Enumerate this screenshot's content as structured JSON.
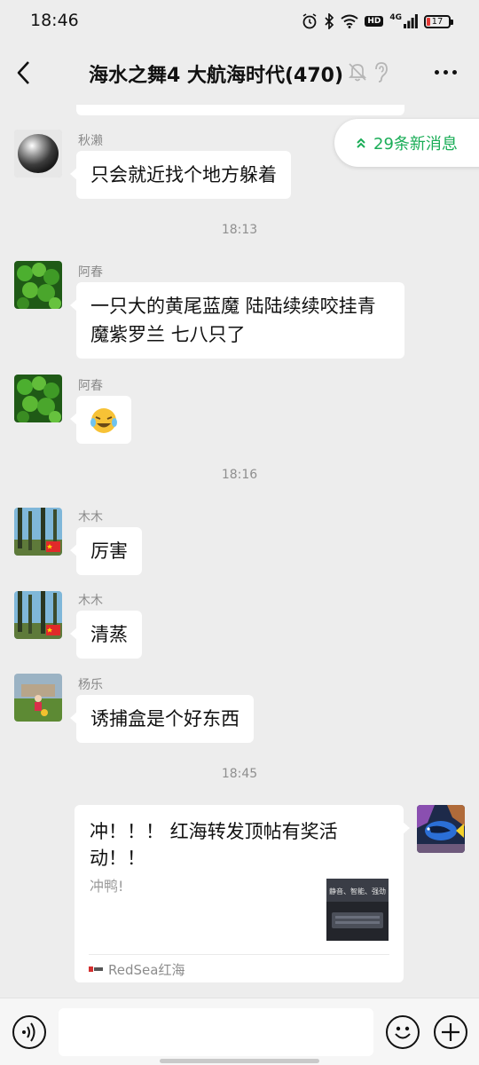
{
  "status_bar": {
    "time": "18:46",
    "battery": "17",
    "network": "4G",
    "hd_badge": "HD"
  },
  "header": {
    "back_icon": "chevron-left-icon",
    "title": "海水之舞4 大航海时代(470)",
    "mute_icon": "bell-off-icon",
    "earpiece_icon": "ear-icon",
    "more_icon": "more-dots-icon"
  },
  "new_messages_pill": {
    "label": "29条新消息",
    "color": "#1aad57"
  },
  "messages": [
    {
      "type": "text",
      "sender": "秋濑",
      "avatar": "silver-sphere-avatar",
      "text": "只会就近找个地方躲着"
    },
    {
      "type": "time",
      "text": "18:13"
    },
    {
      "type": "text",
      "sender": "阿春",
      "avatar": "clover-avatar",
      "text": "一只大的黄尾蓝魔  陆陆续续咬挂青魔紫罗兰  七八只了"
    },
    {
      "type": "emoji",
      "sender": "阿春",
      "avatar": "clover-avatar",
      "emoji": "😂"
    },
    {
      "type": "time",
      "text": "18:16"
    },
    {
      "type": "text",
      "sender": "木木",
      "avatar": "forest-avatar",
      "text": "厉害"
    },
    {
      "type": "text",
      "sender": "木木",
      "avatar": "forest-avatar",
      "text": "清蒸"
    },
    {
      "type": "text",
      "sender": "杨乐",
      "avatar": "child-avatar",
      "text": "诱捕盒是个好东西"
    },
    {
      "type": "time",
      "text": "18:45"
    },
    {
      "type": "link_card",
      "outgoing": true,
      "avatar": "blue-tang-fish-avatar",
      "title": "冲！！！ 红海转发顶帖有奖活动！！",
      "description": "冲鸭!",
      "thumb_text": "静音、智能、强劲",
      "source": "RedSea红海"
    }
  ],
  "input_bar": {
    "voice_icon": "voice-icon",
    "placeholder": "",
    "emoji_icon": "smiley-icon",
    "plus_icon": "plus-icon"
  }
}
